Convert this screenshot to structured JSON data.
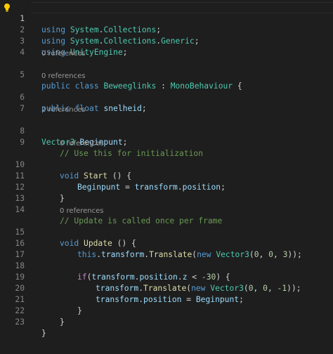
{
  "colors": {
    "background": "#1e1e1e",
    "keyword": "#569cd6",
    "control_keyword": "#c586c0",
    "type": "#4ec9b0",
    "function": "#dcdcaa",
    "variable": "#9cdcfe",
    "number": "#b5cea8",
    "comment": "#6a9955",
    "text": "#d4d4d4",
    "line_number": "#858585",
    "codelens": "#999999",
    "lightbulb": "#ffcc00"
  },
  "gutter": {
    "lightbulb_icon": "lightbulb-icon"
  },
  "lines": {
    "1": {
      "number": "1",
      "t1": "using",
      "t2": "System",
      "t3": ".",
      "t4": "Collections",
      "t5": ";"
    },
    "2": {
      "number": "2",
      "t1": "using",
      "t2": "System",
      "t3": ".",
      "t4": "Collections",
      "t5": ".",
      "t6": "Generic",
      "t7": ";"
    },
    "3": {
      "number": "3",
      "t1": "using",
      "t2": "UnityEngine",
      "t3": ";"
    },
    "4": {
      "number": "4"
    },
    "5": {
      "number": "5",
      "lens": "0 references",
      "t1": "public",
      "t2": "class",
      "t3": "Beweeglinks",
      "t4": " : ",
      "t5": "MonoBehaviour",
      "t6": " {"
    },
    "6": {
      "number": "6",
      "lens": "0 references",
      "t1": "public",
      "t2": "float",
      "t3": "snelheid",
      "t4": ";"
    },
    "7": {
      "number": "7"
    },
    "8": {
      "number": "8",
      "lens": "2 references",
      "t1": "Vector3",
      "t2": "Beginpunt",
      "t3": ";"
    },
    "9": {
      "number": "9",
      "t1": "// Use this for initialization"
    },
    "10": {
      "number": "10",
      "lens": "0 references",
      "t1": "void",
      "t2": "Start",
      "t3": " () {"
    },
    "11": {
      "number": "11",
      "t1": "Beginpunt",
      "t2": " = ",
      "t3": "transform",
      "t4": ".",
      "t5": "position",
      "t6": ";"
    },
    "12": {
      "number": "12",
      "t1": "}"
    },
    "13": {
      "number": "13"
    },
    "14": {
      "number": "14",
      "t1": "// Update is called once per frame"
    },
    "15": {
      "number": "15",
      "lens": "0 references",
      "t1": "void",
      "t2": "Update",
      "t3": " () {"
    },
    "16": {
      "number": "16",
      "t1": "this",
      "t2": ".",
      "t3": "transform",
      "t4": ".",
      "t5": "Translate",
      "t6": "(",
      "t7": "new",
      "t8": "Vector3",
      "t9": "(",
      "t10": "0",
      "t11": ", ",
      "t12": "0",
      "t13": ", ",
      "t14": "3",
      "t15": "));"
    },
    "17": {
      "number": "17"
    },
    "18": {
      "number": "18",
      "t1": "if",
      "t2": "(",
      "t3": "transform",
      "t4": ".",
      "t5": "position",
      "t6": ".",
      "t7": "z",
      "t8": " < ",
      "t9": "-30",
      "t10": ") {"
    },
    "19": {
      "number": "19",
      "t1": "transform",
      "t2": ".",
      "t3": "Translate",
      "t4": "(",
      "t5": "new",
      "t6": "Vector3",
      "t7": "(",
      "t8": "0",
      "t9": ", ",
      "t10": "0",
      "t11": ", ",
      "t12": "-1",
      "t13": "));"
    },
    "20": {
      "number": "20",
      "t1": "transform",
      "t2": ".",
      "t3": "position",
      "t4": " = ",
      "t5": "Beginpunt",
      "t6": ";"
    },
    "21": {
      "number": "21",
      "t1": "}"
    },
    "22": {
      "number": "22",
      "t1": "}"
    },
    "23": {
      "number": "23",
      "t1": "}"
    }
  }
}
